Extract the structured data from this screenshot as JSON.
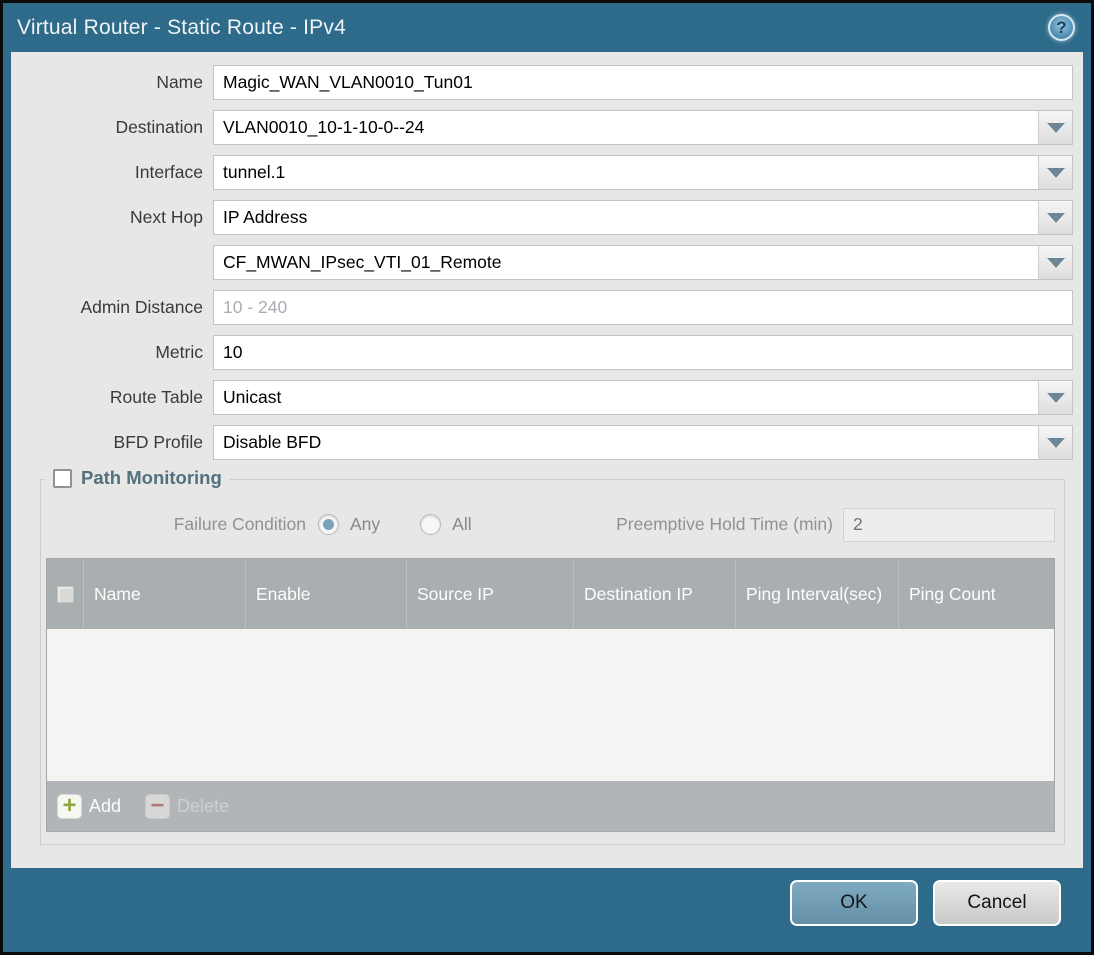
{
  "dialog": {
    "title": "Virtual Router - Static Route - IPv4",
    "help_icon": "?"
  },
  "form": {
    "name": {
      "label": "Name",
      "value": "Magic_WAN_VLAN0010_Tun01"
    },
    "destination": {
      "label": "Destination",
      "value": "VLAN0010_10-1-10-0--24"
    },
    "interface": {
      "label": "Interface",
      "value": "tunnel.1"
    },
    "next_hop": {
      "label": "Next Hop",
      "value": "IP Address"
    },
    "next_hop_address": {
      "value": "CF_MWAN_IPsec_VTI_01_Remote"
    },
    "admin_distance": {
      "label": "Admin Distance",
      "placeholder": "10 - 240",
      "value": ""
    },
    "metric": {
      "label": "Metric",
      "value": "10"
    },
    "route_table": {
      "label": "Route Table",
      "value": "Unicast"
    },
    "bfd_profile": {
      "label": "BFD Profile",
      "value": "Disable BFD"
    }
  },
  "path_monitoring": {
    "title": "Path Monitoring",
    "enabled": false,
    "failure_condition": {
      "label": "Failure Condition",
      "options": [
        {
          "label": "Any",
          "selected": true
        },
        {
          "label": "All",
          "selected": false
        }
      ]
    },
    "preemptive_hold_time": {
      "label": "Preemptive Hold Time (min)",
      "value": "2"
    },
    "table": {
      "columns": [
        "Name",
        "Enable",
        "Source IP",
        "Destination IP",
        "Ping Interval(sec)",
        "Ping Count"
      ],
      "rows": []
    },
    "add_label": "Add",
    "delete_label": "Delete"
  },
  "footer": {
    "ok_label": "OK",
    "cancel_label": "Cancel"
  },
  "colors": {
    "chrome": "#2e6b8a",
    "content-bg": "#e7e7e6",
    "table-header": "#a9aeb1",
    "ok-btn": "#6f9fb7",
    "add-green": "#8aa83d"
  }
}
